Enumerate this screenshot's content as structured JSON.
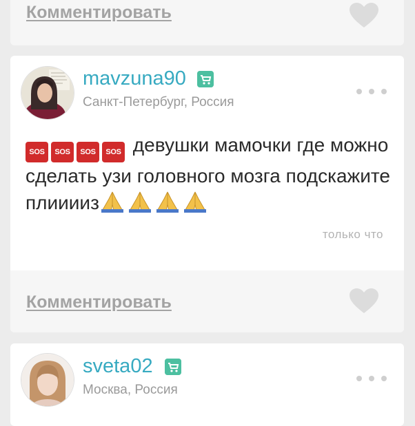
{
  "top_card": {
    "comment_label": "Комментировать"
  },
  "post": {
    "username": "mavzuna90",
    "location": "Санкт-Петербург, Россия",
    "badges": [
      "SOS",
      "SOS",
      "SOS",
      "SOS"
    ],
    "text_before": "девушки мамочки где можно сделать узи  головного мозга подскажите плииииз",
    "timestamp": "только что",
    "comment_label": "Комментировать"
  },
  "next_post": {
    "username": "sveta02",
    "location": "Москва, Россия"
  },
  "colors": {
    "accent": "#37aac1",
    "badge": "#4cbfa0",
    "sos": "#d12b2b",
    "background": "#ececec"
  },
  "icons": [
    "heart-icon",
    "more-dots-icon",
    "stroller-badge-icon",
    "folded-hands-emoji",
    "sos-emoji"
  ]
}
